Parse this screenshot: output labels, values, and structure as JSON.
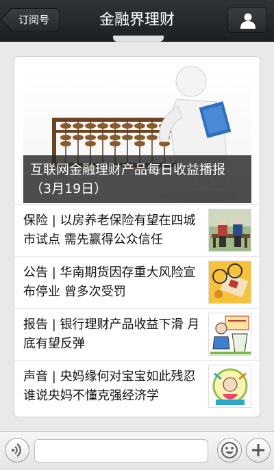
{
  "nav": {
    "back_label": "订阅号",
    "title": "金融界理财",
    "profile_icon": "user-icon"
  },
  "hero": {
    "caption": "互联网金融理财产品每日收益播报（3月19日）",
    "image": "abacus-figure-image"
  },
  "articles": [
    {
      "text": "保险 | 以房养老保险有望在四城市试点 需先赢得公众信任",
      "thumb": "elderly-couple-bench-image"
    },
    {
      "text": "公告 | 华南期货因存重大风险宣布停业 曾多次受罚",
      "thumb": "futures-glasses-image"
    },
    {
      "text": "报告 | 银行理财产品收益下滑 月底有望反弹",
      "thumb": "bank-wealth-cartoon-image"
    },
    {
      "text": "声音 | 央妈缘何对宝宝如此残忍 谁说央妈不懂克强经济学",
      "thumb": "cartoon-baby-image"
    }
  ],
  "bottom": {
    "voice_icon": "voice-icon",
    "emoji_icon": "emoji-icon",
    "plus_icon": "plus-icon",
    "input_value": ""
  },
  "colors": {
    "navbar": "#25282b",
    "caption_bg": "#282828",
    "abacus_wood": "#7a4b22"
  }
}
